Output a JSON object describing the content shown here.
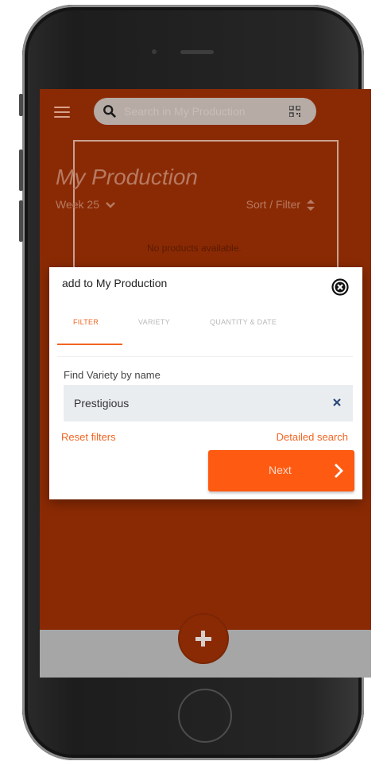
{
  "app": {
    "search_placeholder": "Search in My Production",
    "title": "My Production",
    "week_label": "Week 25",
    "sort_filter_label": "Sort / Filter",
    "empty_message": "No products available."
  },
  "modal": {
    "title": "add to My Production",
    "tabs": [
      {
        "label": "FILTER",
        "active": true
      },
      {
        "label": "VARIETY",
        "active": false
      },
      {
        "label": "QUANTITY & DATE",
        "active": false
      }
    ],
    "find_label": "Find Variety by name",
    "find_value": "Prestigious",
    "reset_label": "Reset filters",
    "detailed_label": "Detailed search",
    "next_label": "Next"
  },
  "colors": {
    "brand_background": "#8a2a04",
    "accent_orange": "#f26522",
    "next_button": "#ff5a12"
  },
  "icons": [
    "hamburger-menu-icon",
    "search-icon",
    "qr-code-icon",
    "chevron-down-icon",
    "sort-icon",
    "close-circle-icon",
    "clear-x-icon",
    "chevron-right-icon",
    "plus-icon"
  ]
}
